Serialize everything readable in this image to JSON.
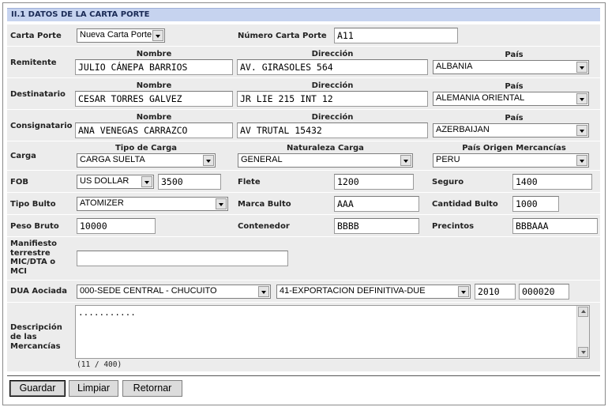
{
  "section_title": "II.1 DATOS DE LA CARTA PORTE",
  "carta_porte": {
    "label": "Carta Porte",
    "select_value": "Nueva Carta Porte",
    "numero_label": "Número Carta Porte",
    "numero_value": "A11"
  },
  "col_headers": {
    "nombre": "Nombre",
    "direccion": "Dirección",
    "pais": "País"
  },
  "remitente": {
    "label": "Remitente",
    "nombre": "JULIO CÁNEPA BARRIOS",
    "direccion": "AV. GIRASOLES 564",
    "pais": "ALBANIA"
  },
  "destinatario": {
    "label": "Destinatario",
    "nombre": "CESAR TORRES GALVEZ",
    "direccion": "JR LIE 215 INT 12",
    "pais": "ALEMANIA ORIENTAL"
  },
  "consignatario": {
    "label": "Consignatario",
    "nombre": "ANA VENEGAS CARRAZCO",
    "direccion": "AV TRUTAL 15432",
    "pais": "AZERBAIJAN"
  },
  "carga": {
    "label": "Carga",
    "tipo_label": "Tipo de Carga",
    "tipo_value": "CARGA SUELTA",
    "naturaleza_label": "Naturaleza Carga",
    "naturaleza_value": "GENERAL",
    "pais_origen_label": "País Origen Mercancías",
    "pais_origen_value": "PERU"
  },
  "fob": {
    "label": "FOB",
    "currency": "US DOLLAR",
    "value": "3500",
    "flete_label": "Flete",
    "flete_value": "1200",
    "seguro_label": "Seguro",
    "seguro_value": "1400"
  },
  "bulto": {
    "tipo_label": "Tipo Bulto",
    "tipo_value": "ATOMIZER",
    "marca_label": "Marca Bulto",
    "marca_value": "AAA",
    "cantidad_label": "Cantidad Bulto",
    "cantidad_value": "1000"
  },
  "peso": {
    "label": "Peso Bruto",
    "value": "10000",
    "contenedor_label": "Contenedor",
    "contenedor_value": "BBBB",
    "precintos_label": "Precintos",
    "precintos_value": "BBBAAA"
  },
  "manifiesto": {
    "label_lines": [
      "Manifiesto",
      "terrestre",
      "MIC/DTA o",
      "MCI"
    ],
    "value": ""
  },
  "dua": {
    "label": "DUA Aociada",
    "aduana": "000-SEDE CENTRAL - CHUCUITO",
    "regimen": "41-EXPORTACION DEFINITIVA-DUE",
    "anio": "2010",
    "numero": "000020"
  },
  "descripcion": {
    "label_lines": [
      "Descripción",
      "de las",
      "Mercancías"
    ],
    "value": "...........",
    "counter": "(11 / 400)"
  },
  "buttons": {
    "guardar": "Guardar",
    "limpiar": "Limpiar",
    "retornar": "Retornar"
  }
}
